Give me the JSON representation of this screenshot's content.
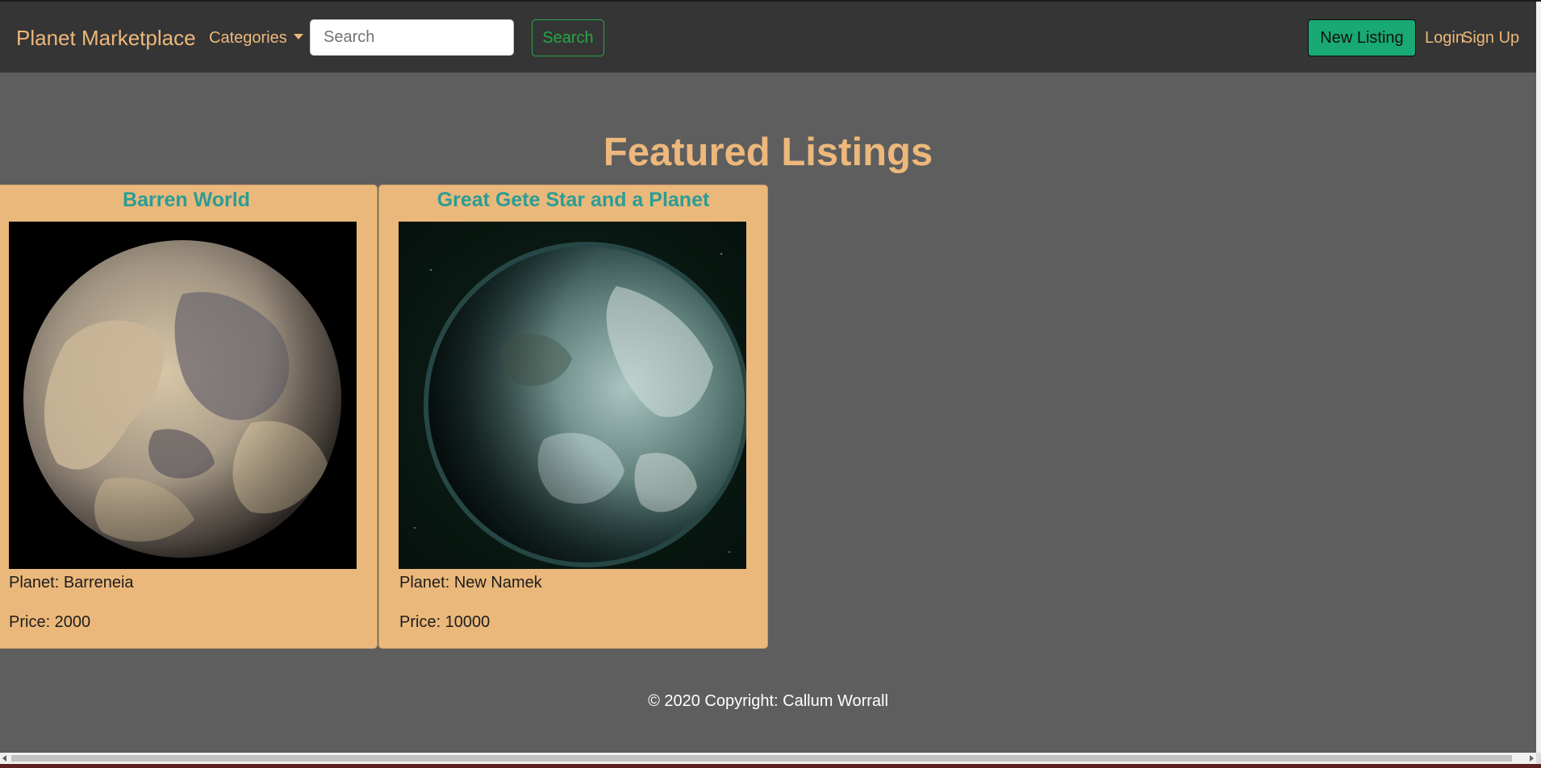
{
  "navbar": {
    "brand": "Planet Marketplace",
    "categories_label": "Categories",
    "search_placeholder": "Search",
    "search_button": "Search",
    "new_listing": "New Listing",
    "login": "Login",
    "signup": "Sign Up"
  },
  "main": {
    "heading": "Featured Listings",
    "listings": [
      {
        "title": "Barren World",
        "planet": "Planet: Barreneia",
        "price": "Price: 2000"
      },
      {
        "title": "Great Gete Star and a Planet",
        "planet": "Planet: New Namek",
        "price": "Price: 10000"
      }
    ]
  },
  "footer": {
    "text": "© 2020 Copyright: Callum Worrall"
  },
  "colors": {
    "page_background": "#5e5e5e",
    "navbar_background": "#353535",
    "accent_orange": "#edb87b",
    "card_background": "#ebb87b",
    "card_title_teal": "#2a9d96",
    "success_green": "#28a745",
    "new_listing_green": "#18a974"
  }
}
